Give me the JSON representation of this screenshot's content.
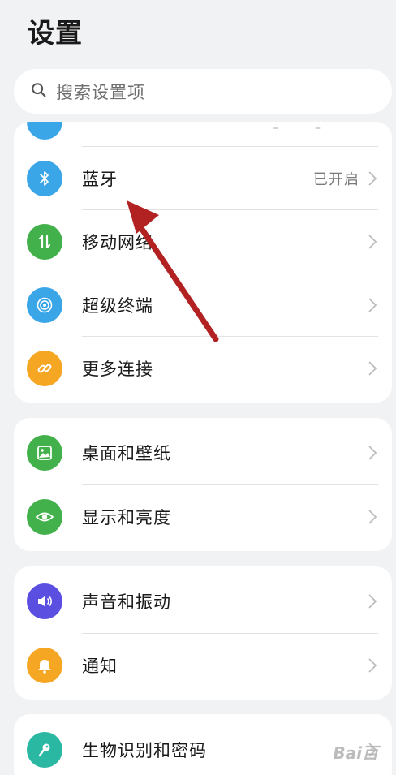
{
  "page": {
    "title": "设置"
  },
  "search": {
    "placeholder": "搜索设置项"
  },
  "groups": [
    {
      "items": [
        {
          "label": "蓝牙",
          "status": "已开启",
          "icon": "bluetooth-icon",
          "color": "#3aa6e8"
        },
        {
          "label": "移动网络",
          "icon": "mobile-data-icon",
          "color": "#43b14b"
        },
        {
          "label": "超级终端",
          "icon": "super-device-icon",
          "color": "#3aa6e8"
        },
        {
          "label": "更多连接",
          "icon": "link-icon",
          "color": "#f5a623"
        }
      ]
    },
    {
      "items": [
        {
          "label": "桌面和壁纸",
          "icon": "wallpaper-icon",
          "color": "#43b14b"
        },
        {
          "label": "显示和亮度",
          "icon": "eye-icon",
          "color": "#43b14b"
        }
      ]
    },
    {
      "items": [
        {
          "label": "声音和振动",
          "icon": "volume-icon",
          "color": "#5a4fe0"
        },
        {
          "label": "通知",
          "icon": "bell-icon",
          "color": "#f5a623"
        }
      ]
    },
    {
      "items": [
        {
          "label": "生物识别和密码",
          "icon": "key-icon",
          "color": "#2ab8a3"
        }
      ]
    }
  ],
  "watermark": "Bai百"
}
